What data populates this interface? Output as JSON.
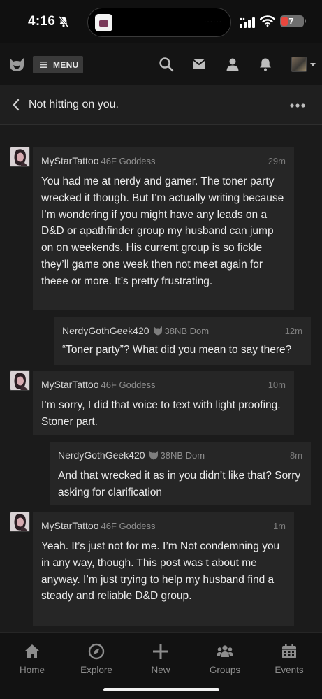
{
  "status_bar": {
    "time": "4:16",
    "battery": "7"
  },
  "top_nav": {
    "menu_label": "MENU"
  },
  "thread": {
    "title": "Not hitting on you."
  },
  "messages": [
    {
      "author": "MyStarTattoo",
      "meta": "46F Goddess",
      "time": "29m",
      "body": "You had me at nerdy and gamer. The toner party wrecked it though. But I’m actually writing because I’m wondering if you might have any leads on a D&D or apathfinder group my husband can jump on on weekends. His current group is so fickle they’ll game one week then not meet again for theee or more. It’s pretty frustrating."
    },
    {
      "author": "NerdyGothGeek420",
      "meta": "38NB Dom",
      "time": "12m",
      "body": "“Toner party”? What did you mean to say there?"
    },
    {
      "author": "MyStarTattoo",
      "meta": "46F Goddess",
      "time": "10m",
      "body": "I’m sorry, I did that voice to text with light proofing. Stoner part."
    },
    {
      "author": "NerdyGothGeek420",
      "meta": "38NB Dom",
      "time": "8m",
      "body": "And that wrecked it as in you didn’t like that? Sorry asking for clarification"
    },
    {
      "author": "MyStarTattoo",
      "meta": "46F Goddess",
      "time": "1m",
      "body": "Yeah. It’s just not for me. I’m Not condemning you in any way, though. This post was t about me anyway. I’m just trying to help my husband find a steady and reliable D&D group."
    }
  ],
  "bottom_nav": {
    "tabs": [
      {
        "label": "Home",
        "icon": "home-icon"
      },
      {
        "label": "Explore",
        "icon": "compass-icon"
      },
      {
        "label": "New",
        "icon": "plus-icon"
      },
      {
        "label": "Groups",
        "icon": "groups-icon"
      },
      {
        "label": "Events",
        "icon": "calendar-icon"
      }
    ]
  },
  "colors": {
    "background": "#1b1b1b",
    "bubble": "#262626",
    "bar": "#141414",
    "battery_low": "#e8473e"
  }
}
